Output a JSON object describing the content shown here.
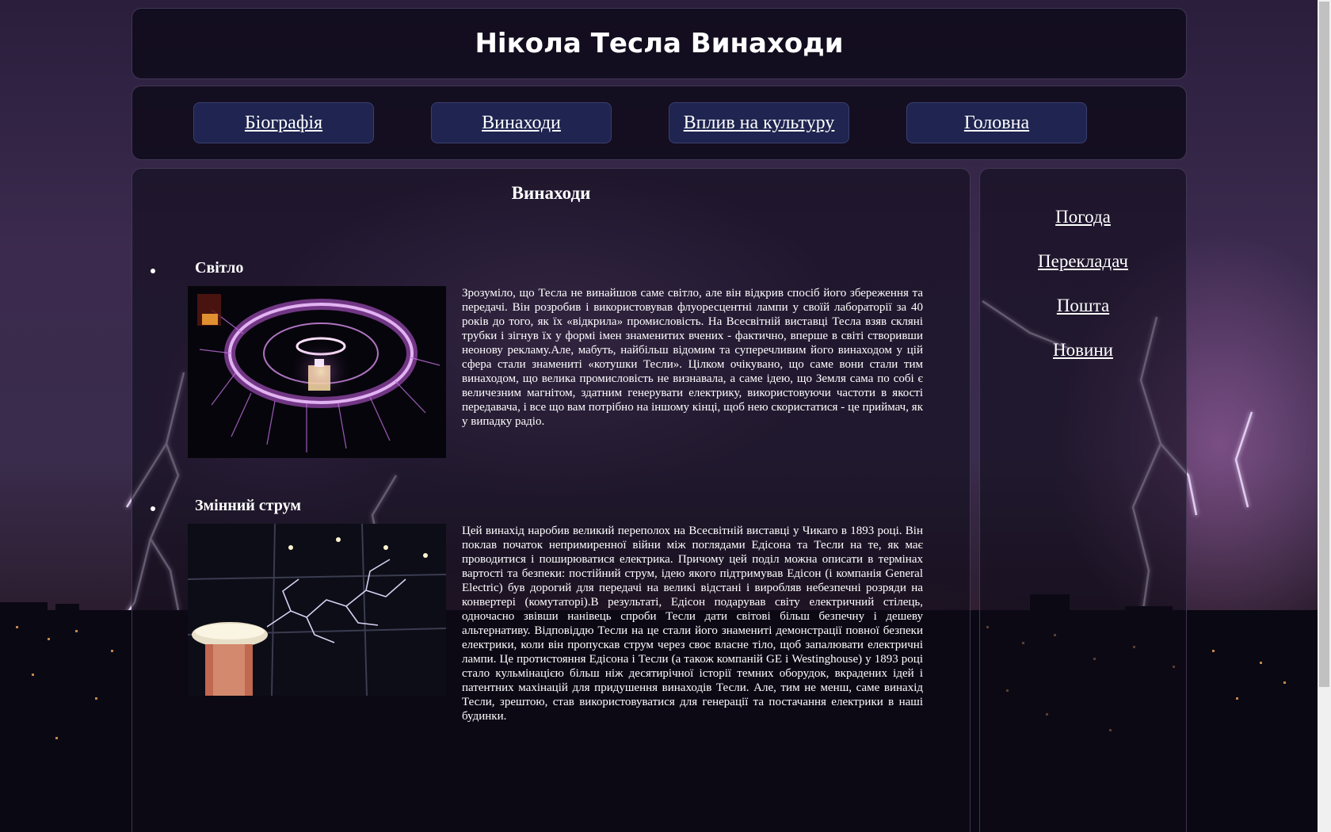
{
  "header": {
    "title": "Нікола Тесла Винаходи"
  },
  "nav": {
    "items": [
      {
        "label": "Біографія"
      },
      {
        "label": "Винаходи"
      },
      {
        "label": "Вплив на культуру"
      },
      {
        "label": "Головна"
      }
    ]
  },
  "main": {
    "title": "Винаходи",
    "items": [
      {
        "title": "Світло",
        "image": "tesla-coil-plasma-ring",
        "text": "Зрозуміло, що Тесла не винайшов саме світло, але він відкрив спосіб його збереження та передачі. Він розробив і використовував флуоресцентні лампи у своїй лабораторії за 40 років до того, як їх «відкрила» промисловість. На Всесвітній виставці Тесла взяв скляні трубки і зігнув їх у формі імен знаменитих вчених - фактично, вперше в світі створивши неонову рекламу.Але, мабуть, найбільш відомим та суперечливим його винаходом у цій сфера стали знамениті «котушки Тесли». Цілком очікувано, що саме вони стали тим винаходом, що велика промисловість не визнавала, а саме ідею, що Земля сама по собі є величезним магнітом, здатним генерувати електрику, використовуючи частоти в якості передавача, і все що вам потрібно на іншому кінці, щоб нею скористатися - це приймач, як у випадку радіо."
      },
      {
        "title": "Змінний струм",
        "image": "tesla-coil-arc-discharge",
        "text": "Цей винахід наробив великий переполох на Всесвітній виставці у Чикаго в 1893 році. Він поклав початок непримиренної війни між поглядами Едісона та Тесли на те, як має проводитися і поширюватися електрика. Причому цей поділ можна описати в термінах вартості та безпеки: постійний струм, ідею якого підтримував Едісон (і компанія General Electric) був дорогий для передачі на великі відстані і виробляв небезпечні розряди на конвертері (комутаторі).В результаті, Едісон подарував світу електричний стілець, одночасно звівши нанівець спроби Тесли дати світові більш безпечну і дешеву альтернативу. Відповіддю Тесли на це стали його знамениті демонстрації повної безпеки електрики, коли він пропускав струм через своє власне тіло, щоб запалювати електричні лампи. Це протистояння Едісона і Тесли (а також компаній GE і Westinghouse) у 1893 році стало кульмінацією більш ніж десятирічної історії темних оборудок, вкрадених ідей і патентних махінацій для придушення винаходів Тесли. Але, тим не менш, саме винахід Тесли, зрештою, став використовуватися для генерації та постачання електрики в наші будинки."
      }
    ]
  },
  "side": {
    "links": [
      {
        "label": "Погода"
      },
      {
        "label": "Перекладач"
      },
      {
        "label": "Пошта"
      },
      {
        "label": "Новини"
      }
    ]
  }
}
